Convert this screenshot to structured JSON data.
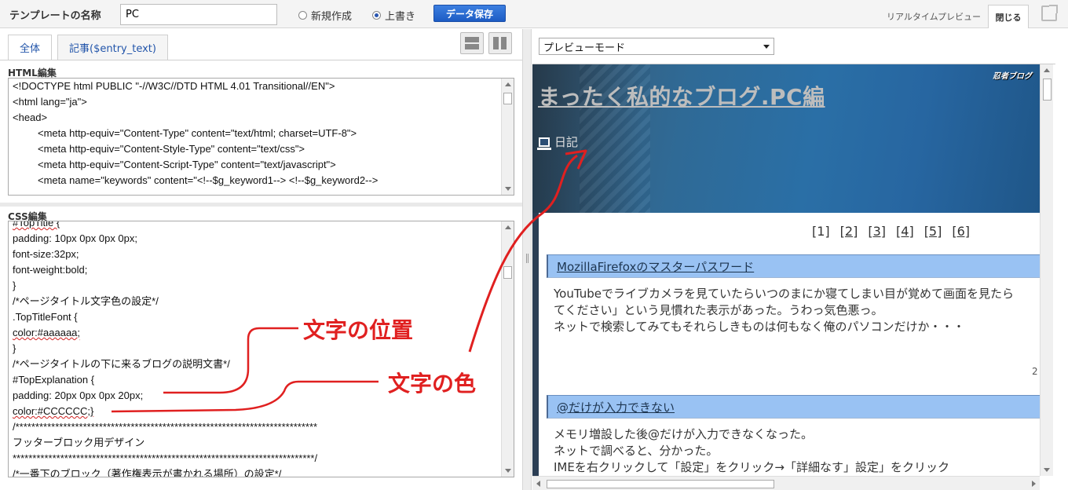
{
  "toolbar": {
    "template_name_label": "テンプレートの名称",
    "template_name_value": "PC",
    "radio_new": "新規作成",
    "radio_overwrite": "上書き",
    "save_button": "データ保存",
    "realtime_preview_tab": "リアルタイムプレビュー",
    "close_tab": "閉じる",
    "selected_mode": "overwrite"
  },
  "editor": {
    "tabs": [
      "全体",
      "記事($entry_text)"
    ],
    "html_section_label": "HTML編集",
    "html_lines": [
      {
        "text": "<!DOCTYPE html PUBLIC \"-//W3C//DTD HTML 4.01 Transitional//EN\">",
        "indent": false
      },
      {
        "text": "<html lang=\"ja\">",
        "indent": false
      },
      {
        "text": "<head>",
        "indent": false
      },
      {
        "text": "<meta http-equiv=\"Content-Type\" content=\"text/html; charset=UTF-8\">",
        "indent": true
      },
      {
        "text": "<meta http-equiv=\"Content-Style-Type\" content=\"text/css\">",
        "indent": true
      },
      {
        "text": "<meta http-equiv=\"Content-Script-Type\" content=\"text/javascript\">",
        "indent": true
      },
      {
        "text": "<meta name=\"keywords\" content=\"<!--$g_keyword1--> <!--$g_keyword2-->",
        "indent": true
      }
    ],
    "css_section_label": "CSS編集",
    "css_lines": [
      {
        "text": "#TopTitle {",
        "squiggle": true
      },
      {
        "text": "padding: 10px 0px 0px 0px;",
        "squiggle": false
      },
      {
        "text": "font-size:32px;",
        "squiggle": false
      },
      {
        "text": "font-weight:bold;",
        "squiggle": false
      },
      {
        "text": "}",
        "squiggle": false
      },
      {
        "text": "/*ページタイトル文字色の設定*/",
        "squiggle": false
      },
      {
        "text": ".TopTitleFont {",
        "squiggle": false
      },
      {
        "text": "color:#aaaaaa;",
        "squiggle": true
      },
      {
        "text": "}",
        "squiggle": false
      },
      {
        "text": "/*ページタイトルの下に来るブログの説明文書*/",
        "squiggle": false
      },
      {
        "text": "#TopExplanation {",
        "squiggle": false
      },
      {
        "text": "padding: 20px 0px 0px 20px;",
        "squiggle": false
      },
      {
        "text": "color:#CCCCCC;}",
        "squiggle": true
      },
      {
        "text": "/****************************************************************************",
        "squiggle": false
      },
      {
        "text": "フッターブロック用デザイン",
        "squiggle": false
      },
      {
        "text": "****************************************************************************/",
        "squiggle": false
      },
      {
        "text": "/*一番下のブロック（著作権表示が書かれる場所）の設定*/",
        "squiggle": false
      }
    ]
  },
  "preview": {
    "mode_select": "プレビューモード",
    "ninja_logo": "忍者ブログ",
    "blog_title": "まったく私的なブログ.PC編",
    "blog_description": "日記",
    "pager": [
      "[1]",
      "[2]",
      "[3]",
      "[4]",
      "[5]",
      "[6]"
    ],
    "entries": [
      {
        "title": "MozillaFirefoxのマスターパスワード",
        "lines": [
          "YouTubeでライブカメラを見ていたらいつのまにか寝てしまい目が覚めて画面を見たら",
          "てください」という見慣れた表示があった。うわっ気色悪っ。",
          "ネットで検索してみてもそれらしきものは何もなく俺のパソコンだけか・・・"
        ],
        "date": "2"
      },
      {
        "title": "@だけが入力できない",
        "lines": [
          "メモリ増設した後@だけが入力できなくなった。",
          "ネットで調べると、分かった。",
          "IMEを右クリックして「設定」をクリック→「詳細なす」設定」をクリック"
        ]
      }
    ]
  },
  "annotations": {
    "label_position": "文字の位置",
    "label_color": "文字の色",
    "arrow_color": "#e02020"
  }
}
